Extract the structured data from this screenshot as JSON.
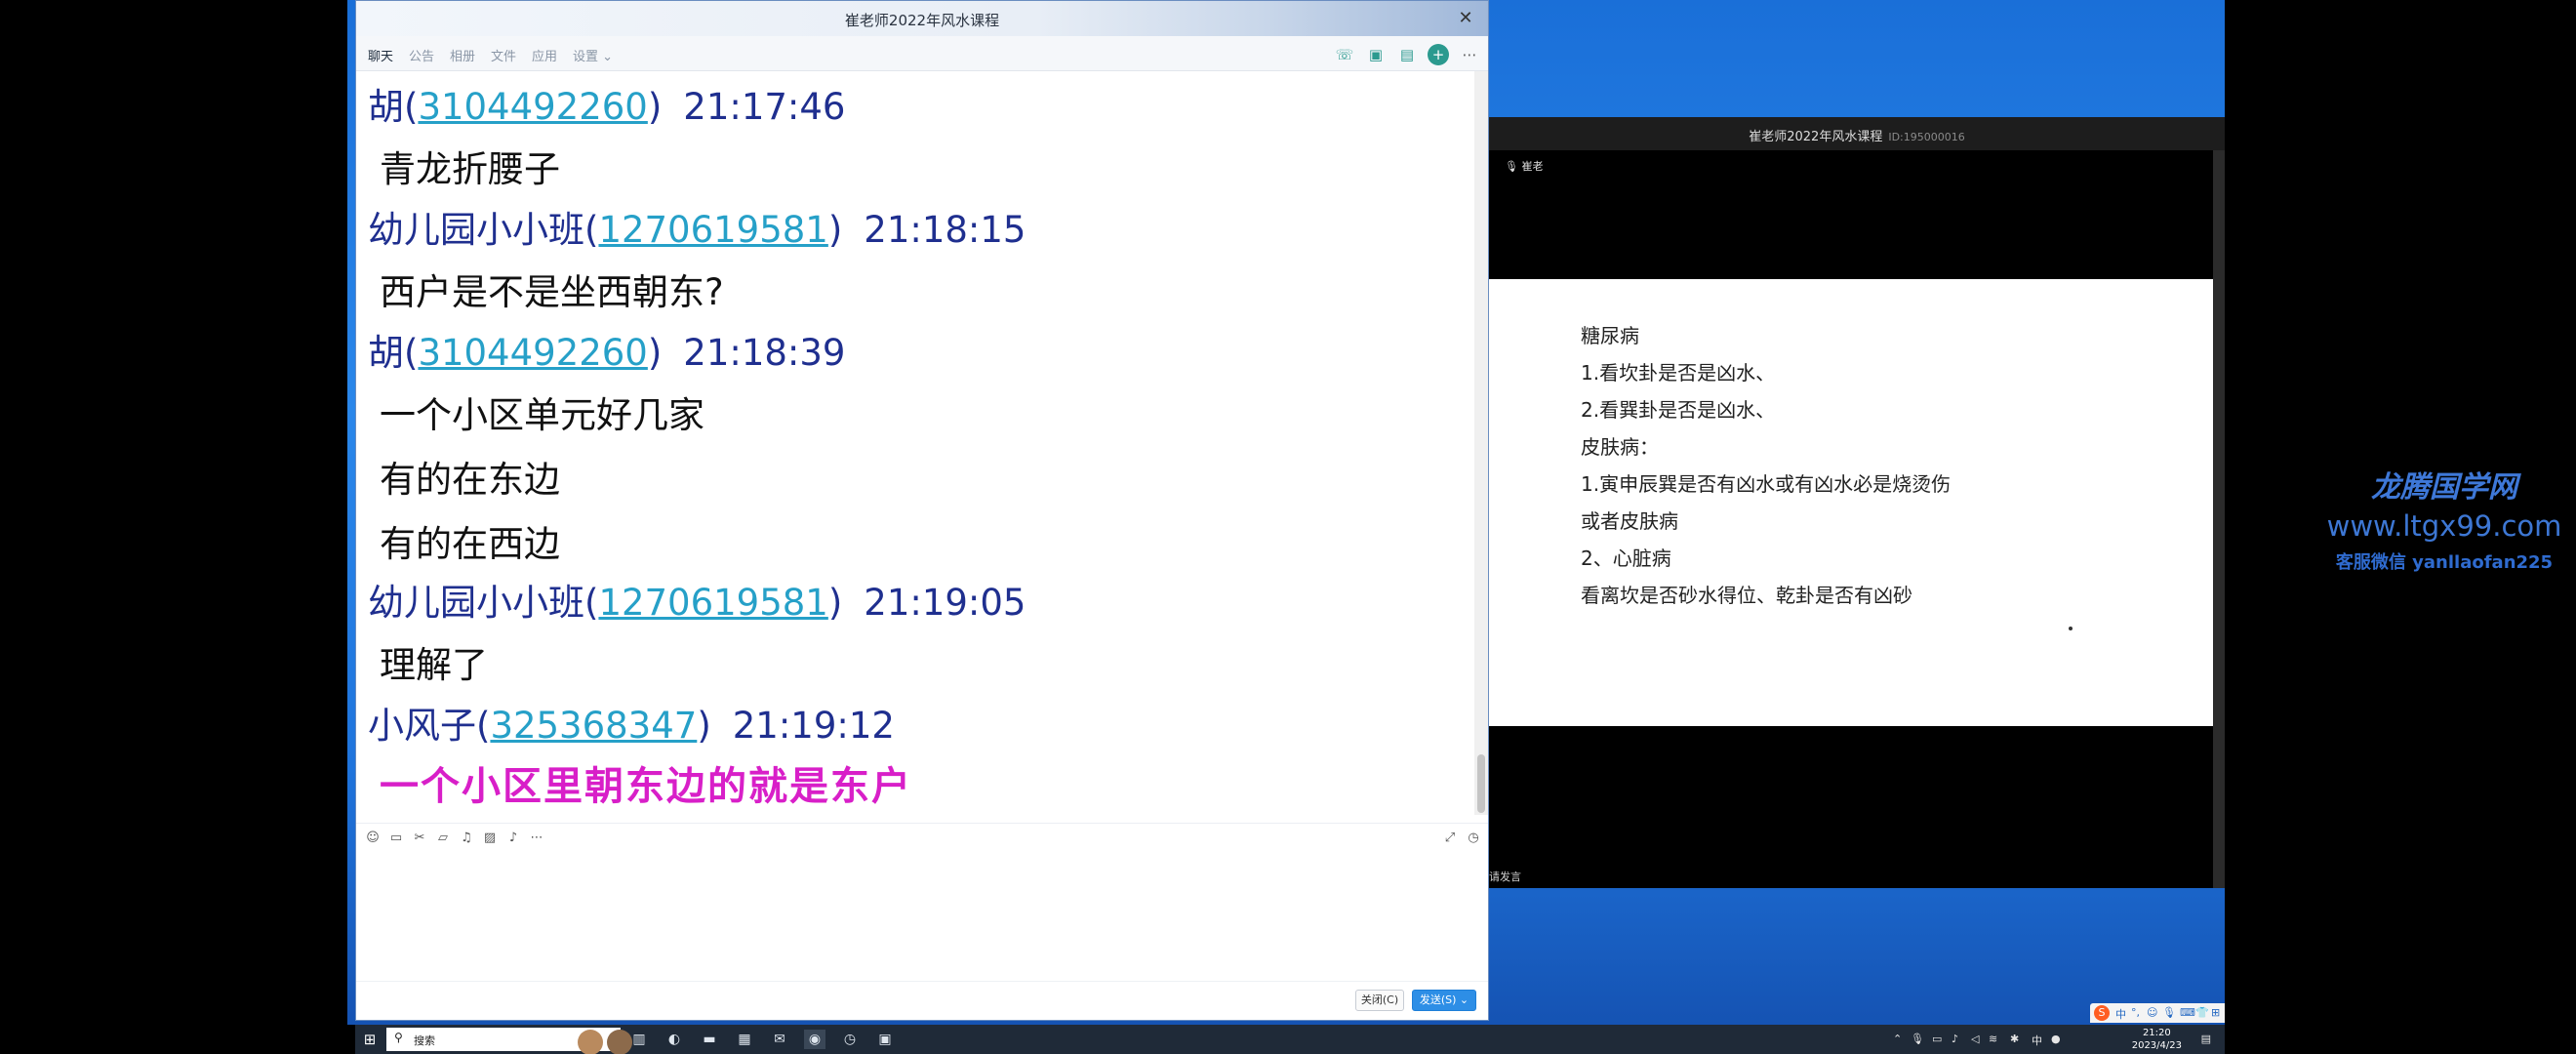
{
  "chat_window": {
    "title": "崔老师2022年风水课程",
    "close_glyph": "✕",
    "tabs": [
      "聊天",
      "公告",
      "相册",
      "文件",
      "应用",
      "设置 ⌄"
    ],
    "top_icons": [
      "phone-icon",
      "video-icon",
      "note-icon",
      "add-icon",
      "more-icon"
    ],
    "messages": [
      {
        "sender": "胡",
        "qq": "3104492260",
        "time": "21:17:46",
        "lines": [
          "青龙折腰子"
        ]
      },
      {
        "sender": "幼儿园小小班",
        "qq": "1270619581",
        "time": "21:18:15",
        "lines": [
          "西户是不是坐西朝东?"
        ]
      },
      {
        "sender": "胡",
        "qq": "3104492260",
        "time": "21:18:39",
        "lines": [
          "一个小区单元好几家",
          "有的在东边",
          "有的在西边"
        ]
      },
      {
        "sender": "幼儿园小小班",
        "qq": "1270619581",
        "time": "21:19:05",
        "lines": [
          "理解了"
        ]
      },
      {
        "sender": "小风子",
        "qq": "325368347",
        "time": "21:19:12",
        "lines": [
          "一个小区里朝东边的就是东户"
        ],
        "highlight": true
      }
    ],
    "footer": {
      "close_label": "关闭(C)",
      "send_label": "发送(S) ⌄"
    }
  },
  "video_window": {
    "title": "崔老师2022年风水课程",
    "room_id": "ID:195000016",
    "tag": "🎙 崔老",
    "bottom_label": "请发言",
    "slide_lines": [
      "糖尿病",
      "1.看坎卦是否是凶水、",
      "2.看巽卦是否是凶水、",
      "皮肤病：",
      "1.寅申辰巽是否有凶水或有凶水必是烧烫伤",
      "或者皮肤病",
      "2、心脏病",
      "看离坎是否砂水得位、乾卦是否有凶砂"
    ]
  },
  "watermark": {
    "name": "龙腾国学网",
    "url": "www.ltgx99.com",
    "wechat": "客服微信 yanllaofan225"
  },
  "taskbar": {
    "search_placeholder": "搜索",
    "tray_lang": "中",
    "tray_time": "21:20",
    "tray_date": "2023/4/23"
  },
  "sogou": {
    "logo": "S",
    "items": [
      "中",
      "°,",
      "☺",
      "🎙",
      "⌨",
      "👕",
      "⊞"
    ]
  },
  "colors": {
    "sender": "#1f2f8f",
    "qq_link": "#26a0c8",
    "highlight_msg": "#d81fc8",
    "send_button": "#2d8ee6",
    "desktop": "#1f74dc"
  }
}
